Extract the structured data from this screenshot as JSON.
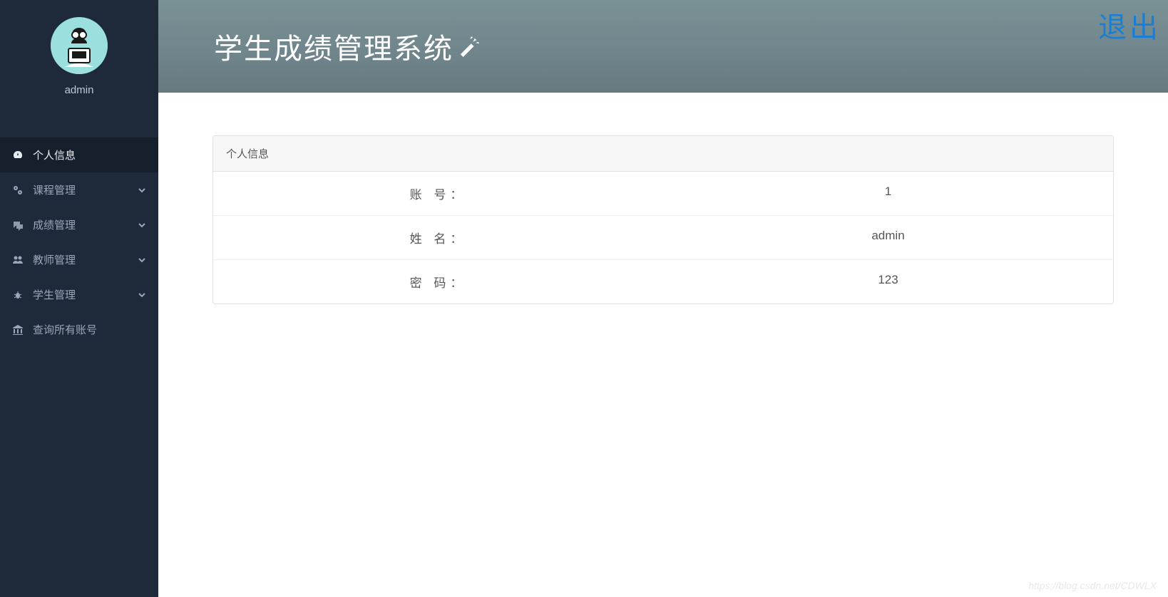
{
  "sidebar": {
    "username": "admin",
    "items": [
      {
        "label": "个人信息",
        "icon": "dashboard-icon",
        "active": true,
        "expandable": false
      },
      {
        "label": "课程管理",
        "icon": "cogs-icon",
        "active": false,
        "expandable": true
      },
      {
        "label": "成绩管理",
        "icon": "comments-icon",
        "active": false,
        "expandable": true
      },
      {
        "label": "教师管理",
        "icon": "users-icon",
        "active": false,
        "expandable": true
      },
      {
        "label": "学生管理",
        "icon": "bug-icon",
        "active": false,
        "expandable": true
      },
      {
        "label": "查询所有账号",
        "icon": "bank-icon",
        "active": false,
        "expandable": false
      }
    ]
  },
  "header": {
    "title": "学生成绩管理系统",
    "logout": "退出"
  },
  "panel": {
    "title": "个人信息",
    "rows": [
      {
        "label": "账 号：",
        "value": "1"
      },
      {
        "label": "姓 名：",
        "value": "admin"
      },
      {
        "label": "密 码：",
        "value": "123"
      }
    ]
  },
  "watermark": "https://blog.csdn.net/CDWLX"
}
